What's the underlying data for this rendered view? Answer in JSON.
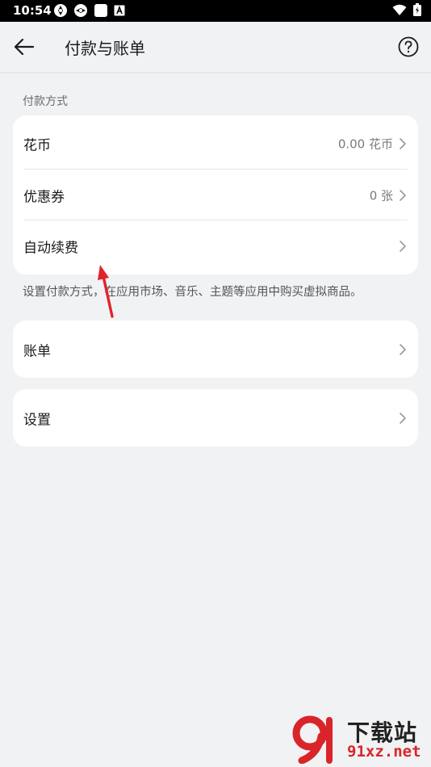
{
  "status_bar": {
    "time": "10:54"
  },
  "header": {
    "title": "付款与账单"
  },
  "payment": {
    "section_label": "付款方式",
    "items": [
      {
        "label": "花币",
        "value": "0.00 花币"
      },
      {
        "label": "优惠券",
        "value": "0 张"
      },
      {
        "label": "自动续费",
        "value": ""
      }
    ],
    "description": "设置付款方式，在应用市场、音乐、主题等应用中购买虚拟商品。"
  },
  "bill": {
    "label": "账单"
  },
  "settings": {
    "label": "设置"
  },
  "watermark": {
    "name": "下载站",
    "url": "91xz.net"
  },
  "colors": {
    "background": "#f1f2f4",
    "card": "#ffffff",
    "arrow": "#e0242b",
    "watermark_red": "#d9252a"
  }
}
